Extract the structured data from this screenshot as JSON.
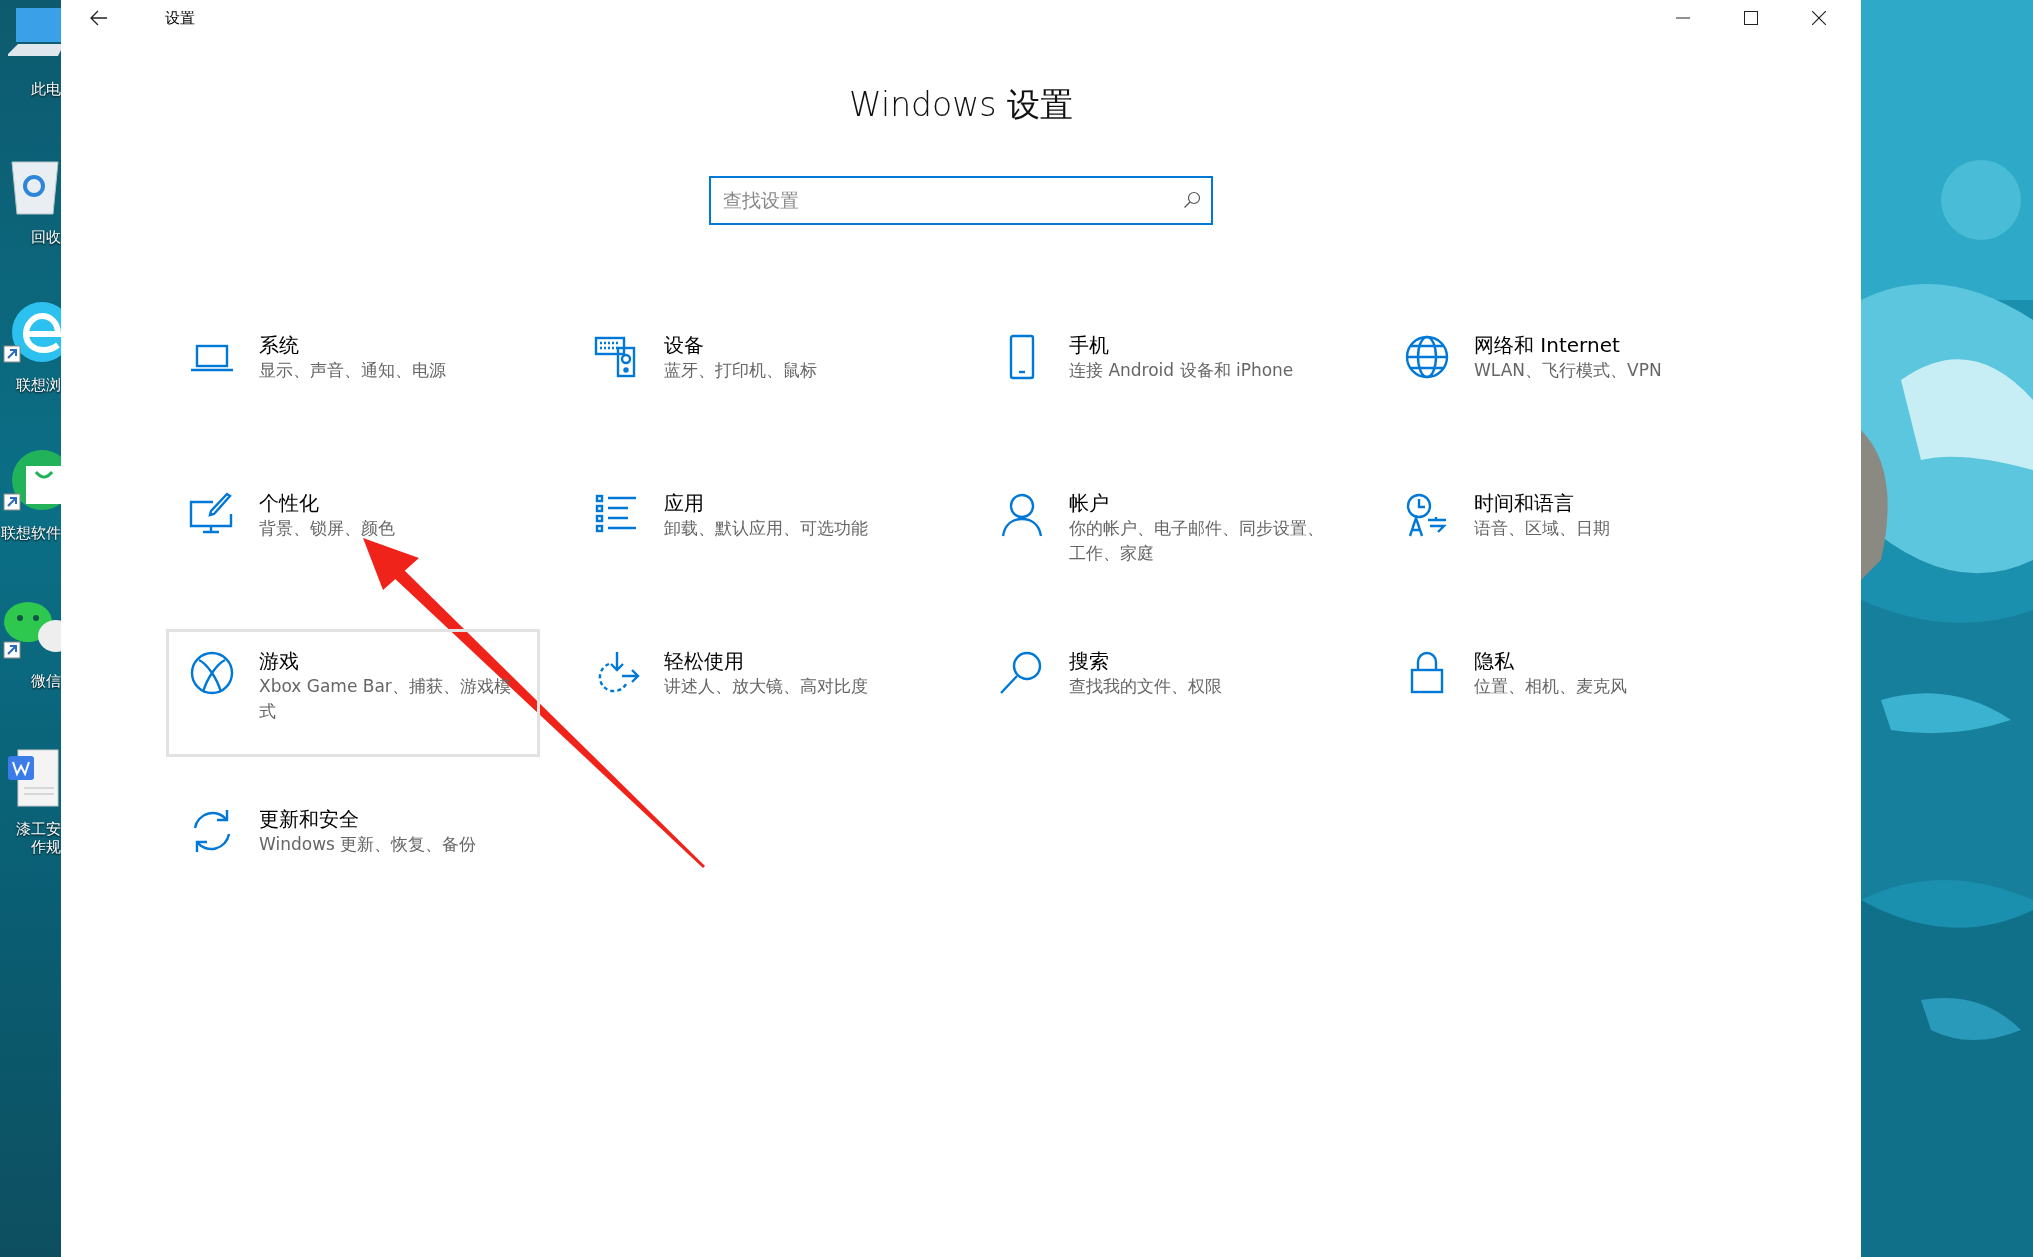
{
  "desktop_icons": [
    {
      "lines": [
        "此电"
      ]
    },
    {
      "lines": [
        "回收"
      ]
    },
    {
      "lines": [
        "联想浏"
      ]
    },
    {
      "lines": [
        "联想软件"
      ]
    },
    {
      "lines": [
        "微信"
      ]
    },
    {
      "lines": [
        "漆工安",
        "作规"
      ]
    }
  ],
  "window": {
    "title": "设置",
    "heading": "Windows 设置",
    "search": {
      "placeholder": "查找设置"
    },
    "tiles": [
      {
        "title": "系统",
        "subtitle": "显示、声音、通知、电源",
        "hovered": false
      },
      {
        "title": "设备",
        "subtitle": "蓝牙、打印机、鼠标",
        "hovered": false
      },
      {
        "title": "手机",
        "subtitle": "连接 Android 设备和 iPhone",
        "hovered": false
      },
      {
        "title": "网络和 Internet",
        "subtitle": "WLAN、飞行模式、VPN",
        "hovered": false
      },
      {
        "title": "个性化",
        "subtitle": "背景、锁屏、颜色",
        "hovered": false
      },
      {
        "title": "应用",
        "subtitle": "卸载、默认应用、可选功能",
        "hovered": false
      },
      {
        "title": "帐户",
        "subtitle": "你的帐户、电子邮件、同步设置、工作、家庭",
        "hovered": false
      },
      {
        "title": "时间和语言",
        "subtitle": "语音、区域、日期",
        "hovered": false
      },
      {
        "title": "游戏",
        "subtitle": "Xbox Game Bar、捕获、游戏模式",
        "hovered": true
      },
      {
        "title": "轻松使用",
        "subtitle": "讲述人、放大镜、高对比度",
        "hovered": false
      },
      {
        "title": "搜索",
        "subtitle": "查找我的文件、权限",
        "hovered": false
      },
      {
        "title": "隐私",
        "subtitle": "位置、相机、麦克风",
        "hovered": false
      },
      {
        "title": "更新和安全",
        "subtitle": "Windows 更新、恢复、备份",
        "hovered": false
      }
    ]
  }
}
